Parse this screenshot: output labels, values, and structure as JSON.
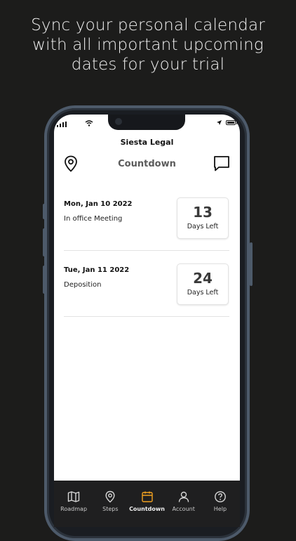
{
  "headline": {
    "line1": "Sync your personal calendar",
    "line2": "with all important upcoming",
    "line3": "dates for your trial"
  },
  "app": {
    "name": "Siesta Legal",
    "page_title": "Countdown"
  },
  "events": [
    {
      "date": "Mon, Jan 10 2022",
      "description": "In office Meeting",
      "days": "13",
      "days_label": "Days Left"
    },
    {
      "date": "Tue, Jan 11 2022",
      "description": "Deposition",
      "days": "24",
      "days_label": "Days Left"
    }
  ],
  "tabs": [
    {
      "label": "Roadmap",
      "icon": "map-icon"
    },
    {
      "label": "Steps",
      "icon": "location-pin-icon"
    },
    {
      "label": "Countdown",
      "icon": "calendar-icon",
      "active": true
    },
    {
      "label": "Account",
      "icon": "user-icon"
    },
    {
      "label": "Help",
      "icon": "help-circle-icon"
    }
  ],
  "colors": {
    "background": "#1c1c1b",
    "accent": "#f0a020",
    "tabbar": "#1f1f20"
  }
}
